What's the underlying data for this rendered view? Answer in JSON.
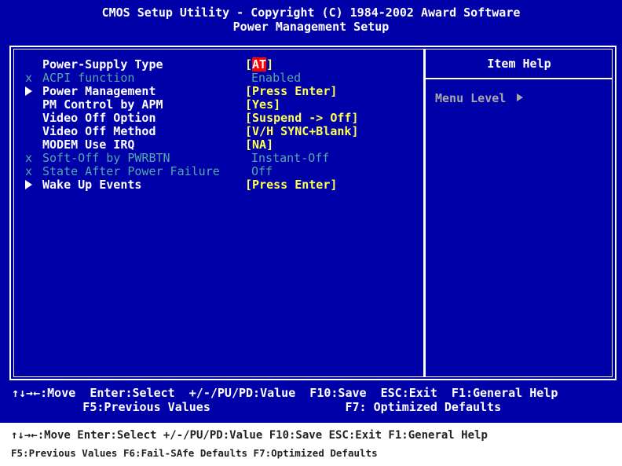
{
  "title": {
    "line1": "CMOS Setup Utility - Copyright (C) 1984-2002 Award Software",
    "line2": "Power Management Setup"
  },
  "settings": [
    {
      "mark": "",
      "label": "Power-Supply Type",
      "value_pre": "[",
      "value_cursor": "AT",
      "value_post": "]",
      "enabled": true
    },
    {
      "mark": "x",
      "label": "ACPI function",
      "value": "Enabled",
      "enabled": false
    },
    {
      "mark": "triangle",
      "label": "Power Management",
      "value": "[Press Enter]",
      "enabled": true
    },
    {
      "mark": "",
      "label": "PM Control by APM",
      "value": "[Yes]",
      "enabled": true
    },
    {
      "mark": "",
      "label": "Video Off Option",
      "value": "[Suspend -> Off]",
      "enabled": true
    },
    {
      "mark": "",
      "label": "Video Off Method",
      "value": "[V/H SYNC+Blank]",
      "enabled": true
    },
    {
      "mark": "",
      "label": "MODEM Use IRQ",
      "value": "[NA]",
      "enabled": true
    },
    {
      "mark": "x",
      "label": "Soft-Off by PWRBTN",
      "value": "Instant-Off",
      "enabled": false
    },
    {
      "mark": "x",
      "label": "State After Power Failure",
      "value": "Off",
      "enabled": false
    },
    {
      "mark": "triangle",
      "label": "Wake Up Events",
      "value": "[Press Enter]",
      "enabled": true
    }
  ],
  "help": {
    "title": "Item Help",
    "menu_level": "Menu Level"
  },
  "keys": {
    "line1": "↑↓→←:Move  Enter:Select  +/-/PU/PD:Value  F10:Save  ESC:Exit  F1:General Help",
    "line2": "          F5:Previous Values                   F7: Optimized Defaults"
  },
  "caption": {
    "line1": "↑↓→←:Move Enter:Select +/-/PU/PD:Value F10:Save ESC:Exit F1:General Help",
    "line2": "F5:Previous Values F6:Fail-SAfe Defaults F7:Optimized Defaults"
  },
  "colors": {
    "background": "#0000a8",
    "label": "#ffffff",
    "value": "#ffff54",
    "disabled": "#54a8a8",
    "cursor": "#ff0000"
  }
}
